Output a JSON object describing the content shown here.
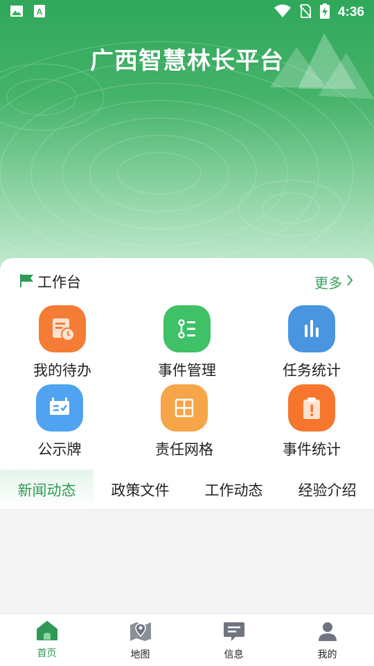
{
  "status_bar": {
    "time": "4:36",
    "left_icons": [
      "image-notification-icon",
      "a-notification-icon"
    ],
    "right_icons": [
      "wifi-icon",
      "no-sim-icon",
      "battery-charging-icon"
    ]
  },
  "header": {
    "title": "广西智慧林长平台"
  },
  "workbench": {
    "title": "工作台",
    "more_label": "更多",
    "items": [
      {
        "label": "我的待办",
        "icon": "todo-clock-icon",
        "color": "#f57c35"
      },
      {
        "label": "事件管理",
        "icon": "event-list-icon",
        "color": "#3fc167"
      },
      {
        "label": "任务统计",
        "icon": "bar-chart-icon",
        "color": "#4a95e0"
      },
      {
        "label": "公示牌",
        "icon": "notice-board-icon",
        "color": "#4fa3f0"
      },
      {
        "label": "责任网格",
        "icon": "grid-icon",
        "color": "#f6a548"
      },
      {
        "label": "事件统计",
        "icon": "clipboard-alert-icon",
        "color": "#f6762e"
      }
    ]
  },
  "tabs": [
    {
      "label": "新闻动态",
      "active": true
    },
    {
      "label": "政策文件",
      "active": false
    },
    {
      "label": "工作动态",
      "active": false
    },
    {
      "label": "经验介绍",
      "active": false
    }
  ],
  "bottom_nav": [
    {
      "label": "首页",
      "icon": "home-icon",
      "active": true
    },
    {
      "label": "地图",
      "icon": "map-pin-icon",
      "active": false
    },
    {
      "label": "信息",
      "icon": "message-icon",
      "active": false
    },
    {
      "label": "我的",
      "icon": "person-icon",
      "active": false
    }
  ],
  "colors": {
    "brand_green": "#2f9a55",
    "active_tab_text": "#2f9a55"
  }
}
